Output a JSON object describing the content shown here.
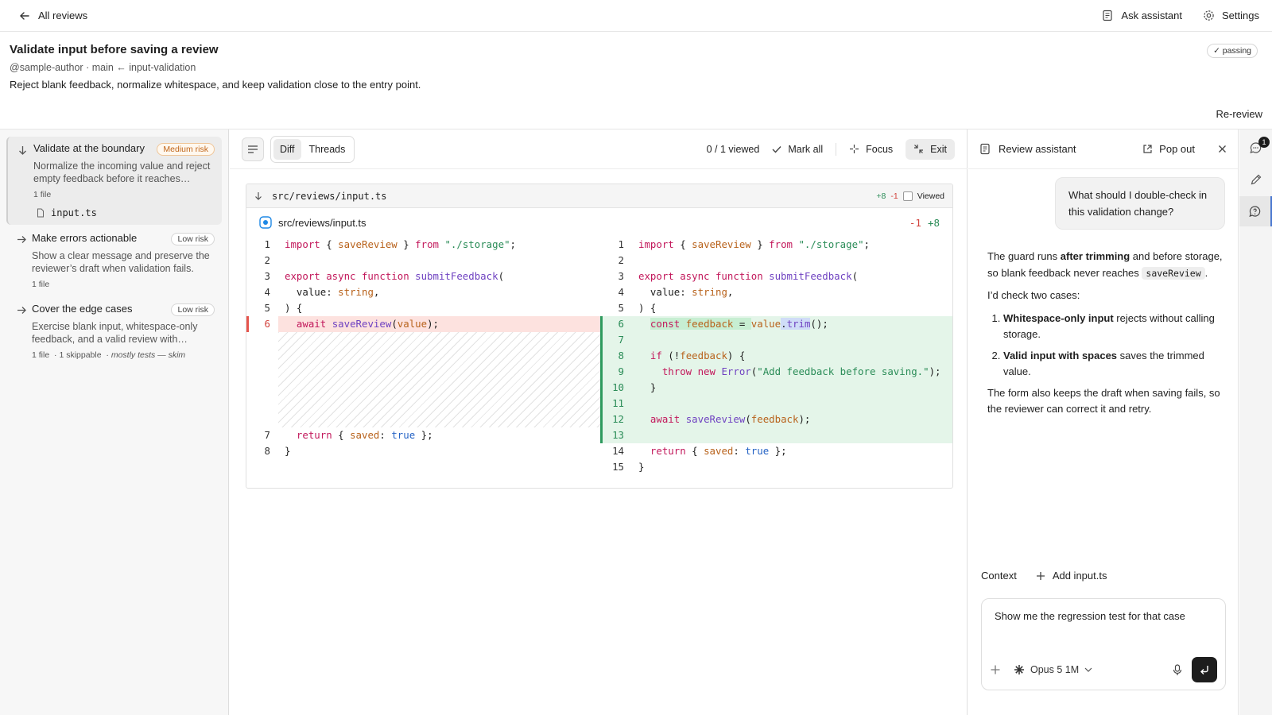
{
  "topbar": {
    "back_label": "All reviews",
    "ask_label": "Ask assistant",
    "settings_label": "Settings"
  },
  "review": {
    "title": "Validate input before saving a review",
    "meta": "@sample-author · main ← input-validation",
    "description": "Reject blank feedback, normalize whitespace, and keep validation close to the entry point.",
    "status": "✓ passing",
    "rereview_label": "Re-review"
  },
  "tasks": [
    {
      "title": "Validate at the boundary",
      "risk": "Medium risk",
      "desc": "Normalize the incoming value and reject empty feedback before it reaches…",
      "files": "1 file",
      "file": "input.ts"
    },
    {
      "title": "Make errors actionable",
      "risk": "Low risk",
      "desc": "Show a clear message and preserve the reviewer’s draft when validation fails.",
      "files": "1 file"
    },
    {
      "title": "Cover the edge cases",
      "risk": "Low risk",
      "desc": "Exercise blank input, whitespace-only feedback, and a valid review with…",
      "files": "1 file",
      "skippable": "· 1 skippable",
      "note": "· mostly tests — skim"
    }
  ],
  "toolbar": {
    "diff_label": "Diff",
    "threads_label": "Threads",
    "viewed_count": "0 / 1 viewed",
    "mark_all_label": "Mark all",
    "focus_label": "Focus",
    "exit_label": "Exit"
  },
  "diff": {
    "path": "src/reviews/input.ts",
    "added": "+8",
    "removed": "-1",
    "viewed_label": "Viewed",
    "file_title": "src/reviews/input.ts",
    "left_lines": [
      "1",
      "2",
      "3",
      "4",
      "5",
      "6",
      "7",
      "8"
    ],
    "right_lines": [
      "1",
      "2",
      "3",
      "4",
      "5",
      "6",
      "7",
      "8",
      "9",
      "10",
      "11",
      "12",
      "13",
      "14",
      "15"
    ]
  },
  "assistant": {
    "title": "Review assistant",
    "popout_label": "Pop out",
    "user_message": "What should I double-check in this validation change?",
    "p1_a": "The guard runs ",
    "p1_b": "after trimming",
    "p1_c": " and before storage, so blank feedback never reaches ",
    "p1_code": "saveReview",
    "p1_d": ".",
    "p2": "I’d check two cases:",
    "li1_b": "Whitespace-only input",
    "li1_t": " rejects without calling storage.",
    "li2_b": "Valid input with spaces",
    "li2_t": " saves the trimmed value.",
    "p3": "The form also keeps the draft when saving fails, so the reviewer can correct it and retry.",
    "context_label": "Context",
    "add_context_label": "Add input.ts",
    "input_value": "Show me the regression test for that case",
    "model_label": "Opus 5 1M"
  },
  "rail": {
    "notification_count": "1"
  },
  "colors": {
    "added": "#2a8c57",
    "removed": "#d2413b",
    "risk_medium": "#c0661a",
    "accent": "#4a78d0"
  },
  "icons": [
    "arrow-left-icon",
    "assistant-icon",
    "gear-icon",
    "arrow-down-icon",
    "arrow-right-icon",
    "file-icon",
    "list-icon",
    "check-icon",
    "focus-icon",
    "exit-icon",
    "popout-icon",
    "close-icon",
    "plus-icon",
    "model-icon",
    "chevron-down-icon",
    "mic-icon",
    "send-icon",
    "chat-icon",
    "pencil-icon",
    "help-icon"
  ]
}
